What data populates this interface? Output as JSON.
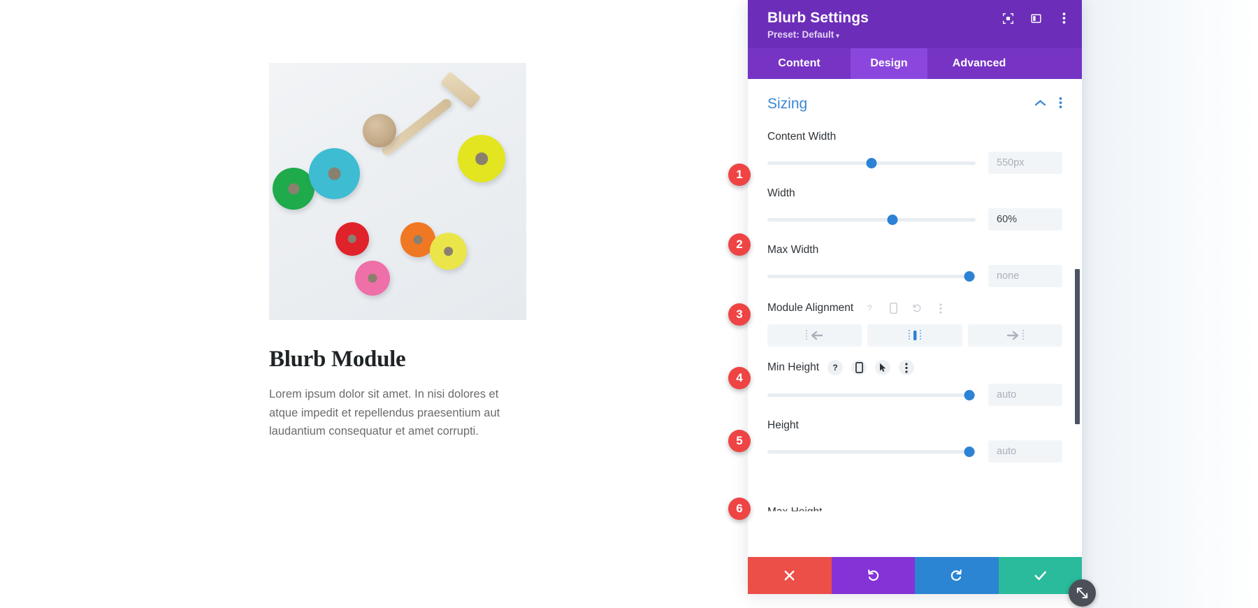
{
  "page": {
    "blurb": {
      "title": "Blurb Module",
      "body": "Lorem ipsum dolor sit amet. In nisi dolores et atque impedit et repellendus praesentium aut laudantium consequatur et amet corrupti.",
      "image_alt": "colorful-wooden-stacking-rings-toy"
    }
  },
  "panel": {
    "title": "Blurb Settings",
    "preset_label": "Preset: Default",
    "preset_caret": "▾",
    "header_icons": [
      {
        "name": "focus-icon",
        "glyph": "focus"
      },
      {
        "name": "layout-panel-icon",
        "glyph": "layout"
      },
      {
        "name": "more-options-icon",
        "glyph": "dots"
      }
    ],
    "tabs": [
      {
        "label": "Content",
        "active": false
      },
      {
        "label": "Design",
        "active": true
      },
      {
        "label": "Advanced",
        "active": false
      }
    ],
    "section": {
      "title": "Sizing",
      "collapse_icon": "chevron-up-icon",
      "menu_icon": "more-options-icon",
      "accent_color": "#3b86d4"
    },
    "fields": [
      {
        "badge": "1",
        "label": "Content Width",
        "value": "550px",
        "is_placeholder": true,
        "slider_percent": 50,
        "icons": []
      },
      {
        "badge": "2",
        "label": "Width",
        "value": "60%",
        "is_placeholder": false,
        "slider_percent": 60,
        "icons": []
      },
      {
        "badge": "3",
        "label": "Max Width",
        "value": "none",
        "is_placeholder": true,
        "slider_percent": 97,
        "icons": []
      }
    ],
    "module_alignment": {
      "badge": "4",
      "label": "Module Alignment",
      "icons": [
        {
          "name": "help-icon",
          "glyph": "?",
          "active": false
        },
        {
          "name": "responsive-mobile-icon",
          "glyph": "mobile",
          "active": false
        },
        {
          "name": "reset-icon",
          "glyph": "reset",
          "active": false
        },
        {
          "name": "more-options-icon",
          "glyph": "dots",
          "active": false
        }
      ],
      "options": [
        {
          "name": "align-left-button",
          "glyph": "align-left",
          "selected": false
        },
        {
          "name": "align-center-button",
          "glyph": "align-center",
          "selected": true
        },
        {
          "name": "align-right-button",
          "glyph": "align-right",
          "selected": false
        }
      ]
    },
    "min_height": {
      "badge": "5",
      "label": "Min Height",
      "value": "auto",
      "is_placeholder": true,
      "slider_percent": 97,
      "icons": [
        {
          "name": "help-icon",
          "glyph": "?",
          "active": true
        },
        {
          "name": "responsive-mobile-icon",
          "glyph": "mobile",
          "active": true
        },
        {
          "name": "hover-cursor-icon",
          "glyph": "cursor",
          "active": true
        },
        {
          "name": "more-options-icon",
          "glyph": "dots",
          "active": true
        }
      ]
    },
    "height": {
      "badge": "6",
      "label": "Height",
      "value": "auto",
      "is_placeholder": true,
      "slider_percent": 97
    },
    "cut_off_label": "Max Height",
    "footer_actions": [
      {
        "name": "cancel-button",
        "glyph": "✕",
        "color": "#ec4e48"
      },
      {
        "name": "undo-button",
        "glyph": "undo",
        "color": "#8533d6"
      },
      {
        "name": "redo-button",
        "glyph": "redo",
        "color": "#2b85d3"
      },
      {
        "name": "save-button",
        "glyph": "✓",
        "color": "#29bb9c"
      }
    ],
    "resize_handle": "resize-handle-icon",
    "colors": {
      "header_purple": "#6c2eb9",
      "tabs_purple": "#7633c4",
      "tab_active_purple": "#8b47dd",
      "slider_blue": "#2c82d4",
      "badge_red": "#ee4444"
    }
  }
}
